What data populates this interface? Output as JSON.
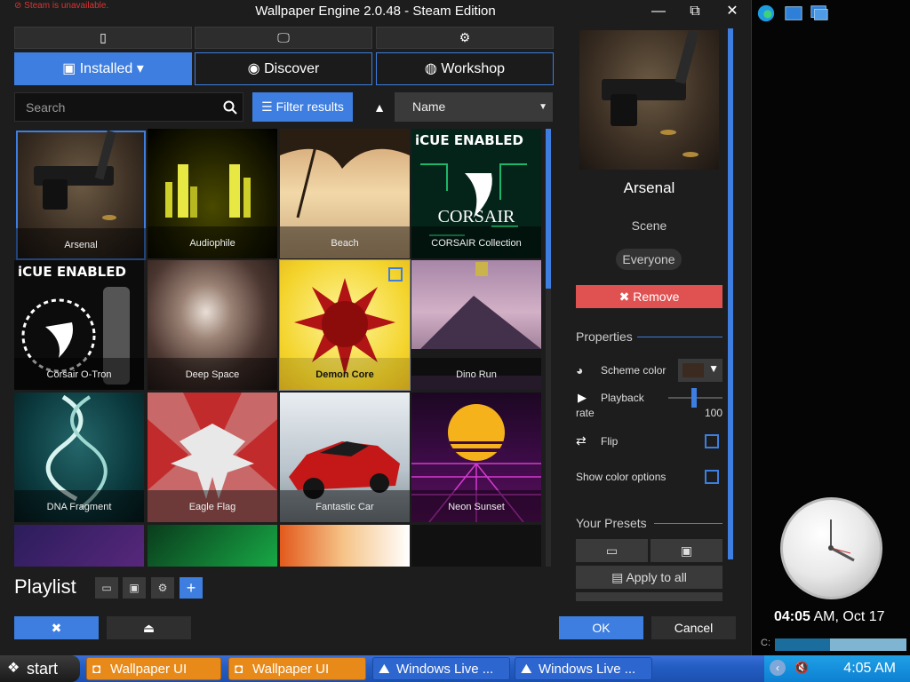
{
  "window": {
    "title": "Wallpaper Engine 2.0.48 - Steam Edition",
    "steam_warning": "Steam is unavailable."
  },
  "tabs": [
    {
      "label": "Installed",
      "active": true
    },
    {
      "label": "Discover",
      "active": false
    },
    {
      "label": "Workshop",
      "active": false
    }
  ],
  "toolbar": {
    "search_placeholder": "Search",
    "filter_label": "Filter results",
    "sort_value": "Name"
  },
  "wallpapers": [
    {
      "label": "Arsenal",
      "selected": true
    },
    {
      "label": "Audiophile"
    },
    {
      "label": "Beach"
    },
    {
      "label": "CORSAIR Collection"
    },
    {
      "label": "Corsair O-Tron"
    },
    {
      "label": "Deep Space"
    },
    {
      "label": "Demon Core"
    },
    {
      "label": "Dino Run"
    },
    {
      "label": "DNA Fragment"
    },
    {
      "label": "Eagle Flag"
    },
    {
      "label": "Fantastic Car"
    },
    {
      "label": "Neon Sunset"
    }
  ],
  "cue_badge": {
    "icue": "iCUE",
    "enabled": "ENABLED",
    "corsair": "CORSAIR"
  },
  "playlist": {
    "label": "Playlist"
  },
  "footer": {
    "ok_label": "OK",
    "cancel_label": "Cancel"
  },
  "detail": {
    "title": "Arsenal",
    "type": "Scene",
    "rating": "Everyone",
    "remove_label": "Remove",
    "properties_header": "Properties",
    "scheme_color_label": "Scheme color",
    "playback_label": "Playback",
    "rate_label": "rate",
    "playback_value": "100",
    "flip_label": "Flip",
    "show_color_label": "Show color options",
    "presets_header": "Your Presets",
    "apply_all_label": "Apply to all"
  },
  "sidebar": {
    "time_bold": "04:05",
    "time_rest": " AM, Oct 17",
    "drive_label": "C:",
    "drive_used_fraction": 0.42
  },
  "taskbar": {
    "start_label": "start",
    "tasks": [
      {
        "label": "Wallpaper UI",
        "active": true
      },
      {
        "label": "Wallpaper UI",
        "active": true
      },
      {
        "label": "Windows Live ...",
        "active": false
      },
      {
        "label": "Windows Live ...",
        "active": false
      }
    ],
    "clock": "4:05 AM"
  }
}
